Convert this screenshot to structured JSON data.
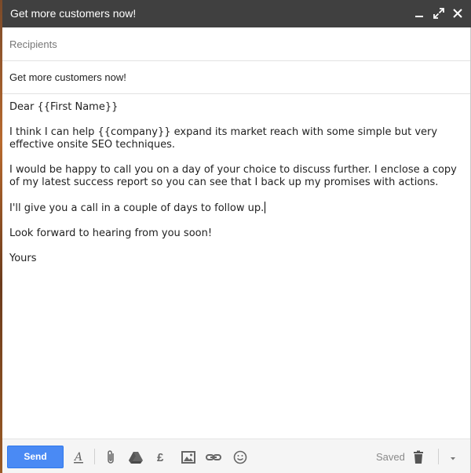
{
  "window": {
    "title": "Get more customers now!",
    "controls": {
      "minimize_icon": "minimize-icon",
      "popout_icon": "expand-icon",
      "close_icon": "close-icon"
    }
  },
  "recipients": {
    "placeholder": "Recipients",
    "value": ""
  },
  "subject": {
    "value": "Get more customers now!"
  },
  "body": {
    "paragraphs": [
      "Dear {{First Name}}",
      "I think I can help {{company}} expand its market reach with some simple but very effective onsite SEO techniques.",
      "I would be happy to call you on a day of your choice to discuss further. I enclose a copy of my latest success report so you can see that I back up my promises with actions.",
      "I'll give you a call in a couple of days to follow up.",
      "Look forward to hearing from you soon!",
      "Yours"
    ]
  },
  "toolbar": {
    "send_label": "Send",
    "saved_label": "Saved",
    "icons": [
      "format-text-icon",
      "attach-icon",
      "drive-icon",
      "pound-icon",
      "photo-icon",
      "link-icon",
      "emoji-icon",
      "trash-icon",
      "more-options-icon"
    ]
  },
  "colors": {
    "titlebar": "#404040",
    "send_button": "#4a8af4",
    "toolbar_icon": "#666666"
  }
}
